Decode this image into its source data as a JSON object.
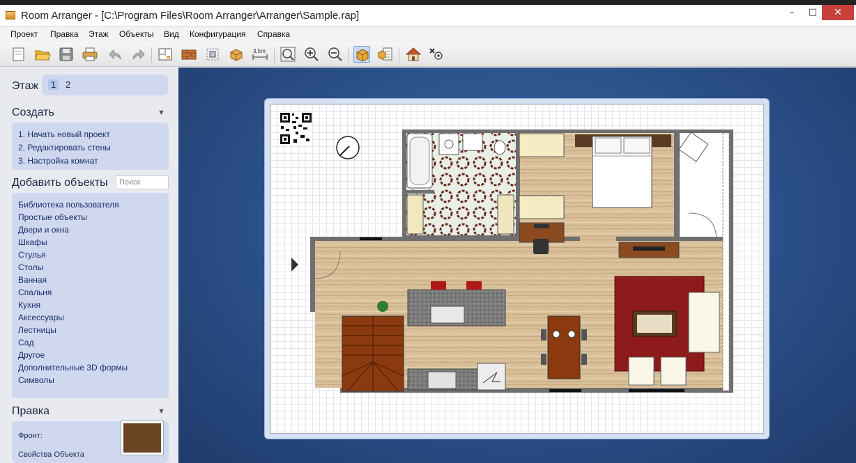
{
  "window": {
    "title": "Room Arranger - [C:\\Program Files\\Room Arranger\\Arranger\\Sample.rap]",
    "minimize": "–",
    "maximize": "□",
    "close": "✕"
  },
  "menu": [
    "Проект",
    "Правка",
    "Этаж",
    "Объекты",
    "Вид",
    "Конфигурация",
    "Справка"
  ],
  "toolbar": {
    "icons": [
      "new-icon",
      "open-icon",
      "save-icon",
      "print-icon",
      "undo-icon",
      "redo-icon",
      "floor-plan-icon",
      "wall-icon",
      "select-icon",
      "objects-icon",
      "measure-icon",
      "zoom-fit-icon",
      "zoom-in-icon",
      "zoom-out-icon",
      "3d-box-icon",
      "object-list-icon",
      "3d-view-icon",
      "settings-icon"
    ],
    "measure_label": "3,5m"
  },
  "sidebar": {
    "floor": {
      "label": "Этаж",
      "tabs": [
        "1",
        "2"
      ],
      "selected": "1"
    },
    "create": {
      "title": "Создать",
      "items": [
        "1. Начать новый проект",
        "2. Редактировать стены",
        "3. Настройка комнат"
      ]
    },
    "add_objects": {
      "title": "Добавить объекты",
      "search_placeholder": "Поиск",
      "items": [
        "Библиотека пользователя",
        "Простые объекты",
        "Двери и окна",
        "Шкафы",
        "Стулья",
        "Столы",
        "Ванная",
        "Спальня",
        "Кухня",
        "Аксессуары",
        "Лестницы",
        "Сад",
        "Другое",
        "Дополнительные 3D формы",
        "Символы"
      ]
    },
    "edit": {
      "title": "Правка",
      "front_label": "Фронт:",
      "properties_label": "Свойства Объекта",
      "front_color": "#6b4424"
    }
  },
  "colors": {
    "canvas_blue": "#2b4f88",
    "panel_blue": "#cfd8ef",
    "wood_floor": "#d9c09a",
    "rug_red": "#8e1b1b",
    "stairs_brown": "#8b3a10",
    "wall_gray": "#6f6f6f"
  }
}
